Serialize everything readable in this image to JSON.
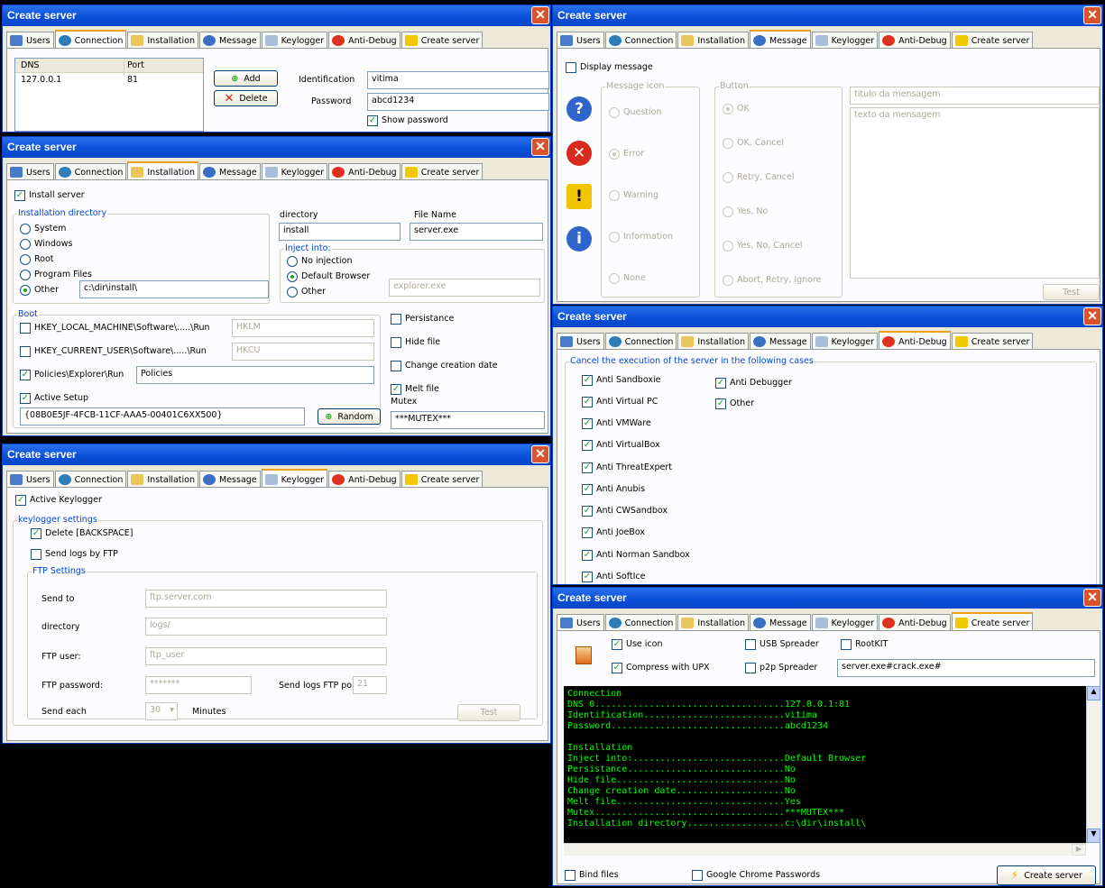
{
  "win_title": "Create server",
  "tabs": [
    "Users",
    "Connection",
    "Installation",
    "Message",
    "Keylogger",
    "Anti-Debug",
    "Create server"
  ],
  "connection": {
    "col_dns": "DNS",
    "col_port": "Port",
    "row_dns": "127.0.0.1",
    "row_port": "81",
    "add": "Add",
    "delete": "Delete",
    "ident_label": "Identification",
    "ident_value": "vitima",
    "pass_label": "Password",
    "pass_value": "abcd1234",
    "show_password": "Show password"
  },
  "installation": {
    "install_server": "Install server",
    "dir_group": "Installation directory",
    "opts": [
      "System",
      "Windows",
      "Root",
      "Program Files",
      "Other"
    ],
    "other_value": "c:\\dir\\install\\",
    "directory_label": "directory",
    "directory_value": "install",
    "filename_label": "File Name",
    "filename_value": "server.exe",
    "inject_group": "Inject into:",
    "inject_opts": [
      "No injection",
      "Default Browser",
      "Other"
    ],
    "inject_other_value": "explorer.exe",
    "boot_group": "Boot",
    "hklm": "HKEY_LOCAL_MACHINE\\Software\\.....\\Run",
    "hklm_value": "HKLM",
    "hkcu": "HKEY_CURRENT_USER\\Software\\.....\\Run",
    "hkcu_value": "HKCU",
    "policies": "Policies\\Explorer\\Run",
    "policies_value": "Policies",
    "active_setup": "Active Setup",
    "active_setup_value": "{08B0E5JF-4FCB-11CF-AAA5-00401C6XX500}",
    "random": "Random",
    "persistance": "Persistance",
    "hide_file": "Hide file",
    "change_date": "Change creation date",
    "melt_file": "Melt file",
    "mutex_label": "Mutex",
    "mutex_value": "***MUTEX***"
  },
  "keylogger": {
    "active": "Active Keylogger",
    "settings_group": "keylogger settings",
    "delete_bs": "Delete [BACKSPACE]",
    "send_ftp": "Send logs by FTP",
    "ftp_group": "FTP Settings",
    "send_to": "Send to",
    "send_to_value": "ftp.server.com",
    "directory": "directory",
    "directory_value": "logs/",
    "ftp_user": "FTP user:",
    "ftp_user_value": "ftp_user",
    "ftp_password": "FTP password:",
    "ftp_password_value": "*******",
    "ftp_port_label": "Send logs FTP por",
    "ftp_port_value": "21",
    "send_each": "Send each",
    "send_each_value": "30",
    "minutes": "Minutes",
    "test": "Test"
  },
  "message": {
    "display": "Display message",
    "icon_group": "Message icon",
    "icons": [
      "Question",
      "Error",
      "Warning",
      "Information",
      "None"
    ],
    "button_group": "Button",
    "buttons": [
      "OK",
      "OK, Cancel",
      "Retry, Cancel",
      "Yes, No",
      "Yes, No, Cancel",
      "Abort, Retry, Ignore"
    ],
    "title_placeholder": "titulo da mensagem",
    "text_placeholder": "texto da mensagem",
    "test": "Test"
  },
  "antidebug": {
    "group": "Cancel the execution of the server in the following cases",
    "col1": [
      "Anti Sandboxie",
      "Anti Virtual PC",
      "Anti VMWare",
      "Anti VirtualBox",
      "Anti ThreatExpert",
      "Anti Anubis",
      "Anti CWSandbox",
      "Anti JoeBox",
      "Anti Norman Sandbox",
      "Anti SoftIce"
    ],
    "col2": [
      "Anti Debugger",
      "Other"
    ]
  },
  "create": {
    "use_icon": "Use icon",
    "compress": "Compress with UPX",
    "usb": "USB Spreader",
    "p2p": "p2p Spreader",
    "rootkit": "RootKIT",
    "filename_value": "server.exe#crack.exe#",
    "log": "Connection\nDNS 0...................................127.0.0.1:81\nIdentification..........................vitima\nPassword................................abcd1234\n\nInstallation\nInject into:............................Default Browser\nPersistance.............................No\nHide file...............................No\nChange creation date....................No\nMelt file...............................Yes\nMutex...................................***MUTEX***\nInstallation directory..................c:\\dir\\install\\",
    "bind_files": "Bind files",
    "chrome": "Google Chrome Passwords",
    "create_button": "Create server"
  },
  "colors": {
    "title_bar": "#0a50d8",
    "console_text": "#00ff00"
  }
}
